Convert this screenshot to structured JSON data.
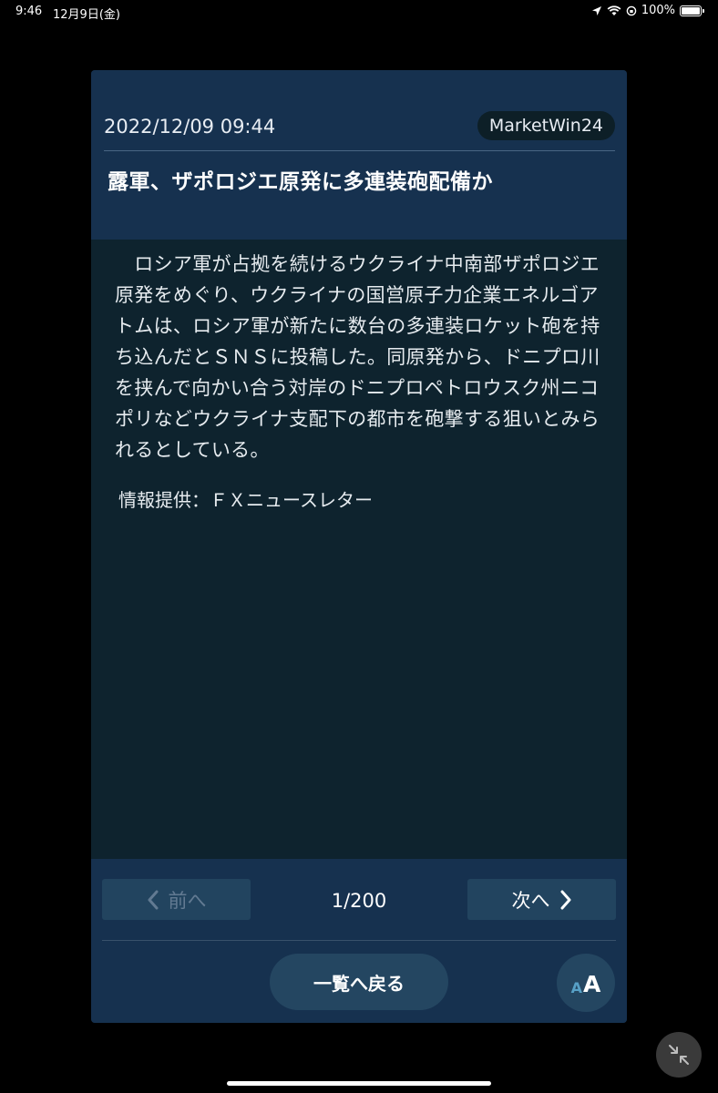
{
  "status_bar": {
    "time": "9:46",
    "date": "12月9日(金)",
    "battery": "100%"
  },
  "article": {
    "timestamp": "2022/12/09 09:44",
    "source": "MarketWin24",
    "headline": "露軍、ザポロジエ原発に多連装砲配備か",
    "body": "　ロシア軍が占拠を続けるウクライナ中南部ザポロジエ原発をめぐり、ウクライナの国営原子力企業エネルゴアトムは、ロシア軍が新たに数台の多連装ロケット砲を持ち込んだとＳＮＳに投稿した。同原発から、ドニプロ川を挟んで向かい合う対岸のドニプロペトロウスク州ニコポリなどウクライナ支配下の都市を砲撃する狙いとみられるとしている。",
    "credit": "情報提供：ＦＸニュースレター"
  },
  "navigation": {
    "prev_label": "前へ",
    "next_label": "次へ",
    "page_counter": "1/200",
    "back_label": "一覧へ戻る",
    "font_small": "A",
    "font_large": "A"
  },
  "colors": {
    "header_bg": "#16314f",
    "body_bg": "#0e232e",
    "button_bg": "#22445f",
    "accent": "#57a0c6"
  },
  "icons": {
    "prev": "chevron-left-icon",
    "next": "chevron-right-icon",
    "exit_fullscreen": "collapse-arrows-icon"
  }
}
